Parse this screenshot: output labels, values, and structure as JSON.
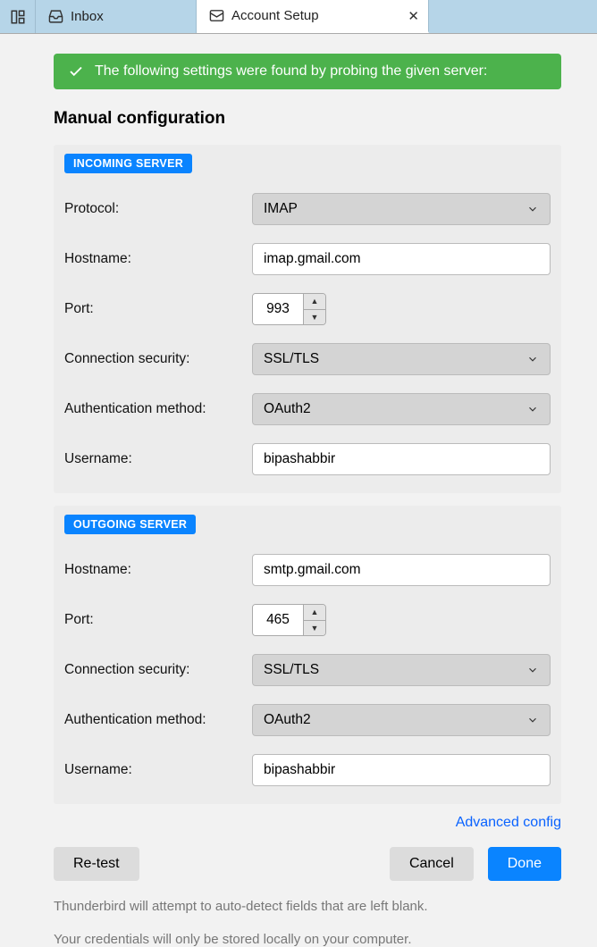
{
  "tabs": {
    "inbox": "Inbox",
    "account_setup": "Account Setup"
  },
  "banner": {
    "text": "The following settings were found by probing the given server:"
  },
  "section_title": "Manual configuration",
  "incoming": {
    "heading": "INCOMING SERVER",
    "labels": {
      "protocol": "Protocol:",
      "hostname": "Hostname:",
      "port": "Port:",
      "connsec": "Connection security:",
      "auth": "Authentication method:",
      "username": "Username:"
    },
    "values": {
      "protocol": "IMAP",
      "hostname": "imap.gmail.com",
      "port": "993",
      "connsec": "SSL/TLS",
      "auth": "OAuth2",
      "username": "bipashabbir"
    }
  },
  "outgoing": {
    "heading": "OUTGOING SERVER",
    "labels": {
      "hostname": "Hostname:",
      "port": "Port:",
      "connsec": "Connection security:",
      "auth": "Authentication method:",
      "username": "Username:"
    },
    "values": {
      "hostname": "smtp.gmail.com",
      "port": "465",
      "connsec": "SSL/TLS",
      "auth": "OAuth2",
      "username": "bipashabbir"
    }
  },
  "advanced_link": "Advanced config",
  "buttons": {
    "retest": "Re-test",
    "cancel": "Cancel",
    "done": "Done"
  },
  "hints": {
    "autodetect": "Thunderbird will attempt to auto-detect fields that are left blank.",
    "credentials": "Your credentials will only be stored locally on your computer."
  }
}
